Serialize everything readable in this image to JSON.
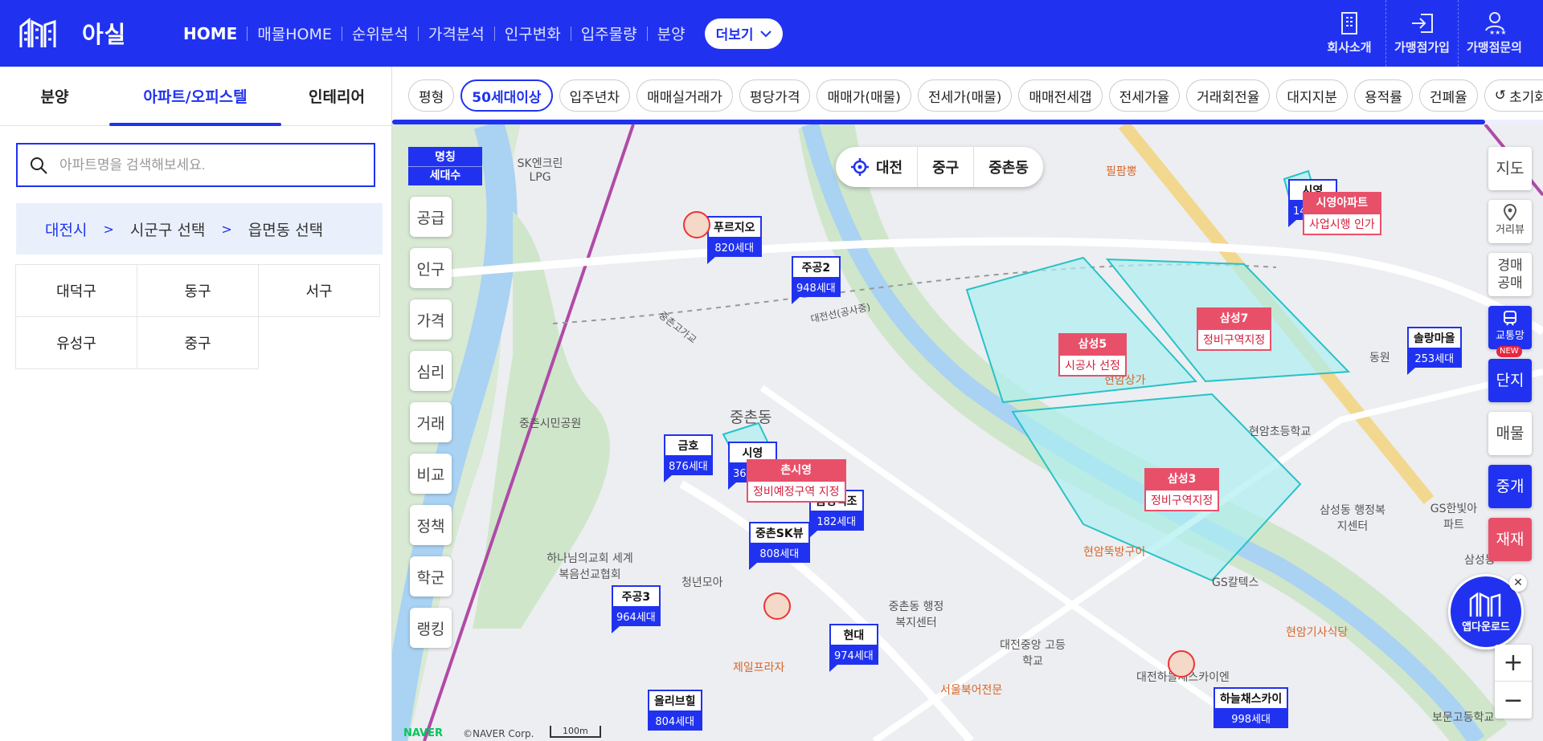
{
  "header": {
    "brand": "아실",
    "nav": [
      "HOME",
      "매물HOME",
      "순위분석",
      "가격분석",
      "인구변화",
      "입주물량",
      "분양"
    ],
    "more_label": "더보기",
    "right_items": [
      {
        "label": "회사소개",
        "icon": "building-icon"
      },
      {
        "label": "가맹점가입",
        "icon": "login-icon"
      },
      {
        "label": "가맹점문의",
        "icon": "user-stars-icon"
      }
    ]
  },
  "sidebar": {
    "tabs": [
      "분양",
      "아파트/오피스텔",
      "인테리어"
    ],
    "active_tab": "아파트/오피스텔",
    "search_placeholder": "아파트명을 검색해보세요.",
    "breadcrumb": {
      "city": "대전시",
      "district": "시군구 선택",
      "dong": "읍면동 선택",
      "separator": ">"
    },
    "districts": [
      [
        "대덕구",
        "동구",
        "서구"
      ],
      [
        "유성구",
        "중구"
      ]
    ]
  },
  "map": {
    "filter_chips": [
      "평형",
      "50세대이상",
      "입주년차",
      "매매실거래가",
      "평당가격",
      "매매가(매물)",
      "전세가(매물)",
      "매매전세갭",
      "전세가율",
      "거래회전율",
      "대지지분",
      "용적률",
      "건폐율",
      "초기화"
    ],
    "active_chip": "50세대이상",
    "progress": 0.95,
    "name_toggle": {
      "top": "명칭",
      "bottom": "세대수"
    },
    "left_rail": [
      "공급",
      "인구",
      "가격",
      "심리",
      "거래",
      "비교",
      "정책",
      "학군",
      "랭킹"
    ],
    "location": {
      "city": "대전",
      "district": "중구",
      "dong": "중촌동"
    },
    "right_rail": {
      "map": "지도",
      "distance": "거리뷰",
      "auction": "경매공매",
      "transit": "교통망",
      "new_badge": "NEW",
      "complex": "단지",
      "listing": "매물",
      "broker": "중개",
      "redev": "재재"
    },
    "app_download": "앱다운로드",
    "markers": [
      {
        "name": "푸르지오",
        "units": "820세대"
      },
      {
        "name": "주공2",
        "units": "948세대"
      },
      {
        "name": "시영",
        "units": "140세대"
      },
      {
        "name": "솔랑마을",
        "units": "253세대"
      },
      {
        "name": "금호",
        "units": "876세대"
      },
      {
        "name": "시영",
        "units": "360세대"
      },
      {
        "name": "금성백조",
        "units": "182세대"
      },
      {
        "name": "중촌SK뷰",
        "units": "808세대"
      },
      {
        "name": "주공3",
        "units": "964세대"
      },
      {
        "name": "현대",
        "units": "974세대"
      },
      {
        "name": "올리브힐",
        "units": "804세대"
      },
      {
        "name": "하늘채스카이",
        "units": "998세대"
      }
    ],
    "redev_markers": [
      {
        "name": "삼성5",
        "status": "시공사 선정"
      },
      {
        "name": "삼성7",
        "status": "정비구역지정"
      },
      {
        "name": "삼성3",
        "status": "정비구역지정"
      },
      {
        "name": "시영아파트",
        "status": "사업시행 인가"
      },
      {
        "name": "촌시영",
        "status": "정비예정구역 지정"
      }
    ],
    "place_labels": [
      "중촌동",
      "중촌시민공원",
      "SK엔크린 LPG",
      "필팜뽕",
      "현암상가",
      "현암초등학교",
      "삼성동 행정복지센터",
      "GS한빛아파트",
      "현암뚝방구이",
      "GS칼텍스",
      "현암기사식당",
      "대전중앙 고등학교",
      "서울북어전문",
      "제일프라자",
      "중촌동 행정복지센터",
      "대전하늘채스카이엔",
      "보문고등학교",
      "하나님의교회 세계복음선교협회",
      "청년모아",
      "삼성동",
      "동원",
      "대전선(공사중)",
      "중촌고가교"
    ],
    "attribution": {
      "naver": "NAVER",
      "copyright": "©NAVER Corp.",
      "scale": "100m"
    }
  }
}
